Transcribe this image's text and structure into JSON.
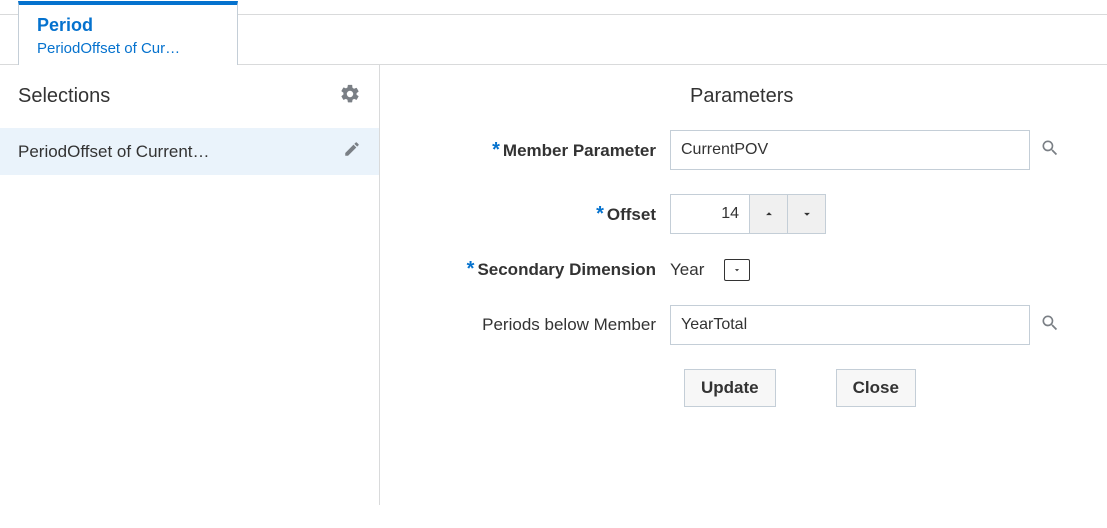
{
  "tab": {
    "title": "Period",
    "subtitle": "PeriodOffset of Cur…"
  },
  "left": {
    "heading": "Selections",
    "items": [
      {
        "label": "PeriodOffset of Current…"
      }
    ]
  },
  "right": {
    "heading": "Parameters",
    "fields": {
      "member_parameter": {
        "label": "Member Parameter",
        "value": "CurrentPOV",
        "required": true
      },
      "offset": {
        "label": "Offset",
        "value": "14",
        "required": true
      },
      "secondary_dimension": {
        "label": "Secondary Dimension",
        "value": "Year",
        "required": true
      },
      "periods_below_member": {
        "label": "Periods below Member",
        "value": "YearTotal",
        "required": false
      }
    },
    "buttons": {
      "update": "Update",
      "close": "Close"
    }
  }
}
